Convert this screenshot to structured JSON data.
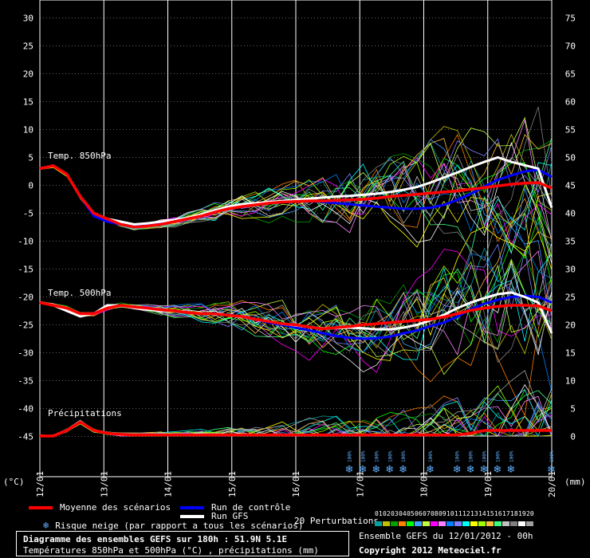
{
  "chart_data": {
    "type": "line",
    "x_dates": [
      "12/01",
      "13/01",
      "14/01",
      "15/01",
      "16/01",
      "17/01",
      "18/01",
      "19/01",
      "20/01"
    ],
    "x_step_hours": 6,
    "left_axis": {
      "unit": "(°C)",
      "ticks": [
        30,
        25,
        20,
        15,
        10,
        5,
        0,
        -5,
        -10,
        -15,
        -20,
        -25,
        -30,
        -35,
        -40,
        -45
      ]
    },
    "right_axis": {
      "unit": "(mm)",
      "ticks": [
        75,
        70,
        65,
        60,
        55,
        50,
        45,
        40,
        35,
        30,
        25,
        20,
        15,
        10,
        5,
        0
      ]
    },
    "panel_labels": [
      "Temp. 850hPa",
      "Temp. 500hPa",
      "Précipitations"
    ],
    "series": [
      {
        "name": "Moyenne des scénarios",
        "color": "#ff0000",
        "t850": [
          3,
          3.5,
          2,
          -2,
          -5,
          -6,
          -7,
          -7.5,
          -7.3,
          -7,
          -6.5,
          -6,
          -5.5,
          -4.8,
          -4.2,
          -3.8,
          -3.5,
          -3.2,
          -3,
          -2.9,
          -2.8,
          -2.8,
          -2.7,
          -2.6,
          -2.5,
          -2.3,
          -2.0,
          -1.8,
          -1.6,
          -1.4,
          -1.2,
          -1.0,
          -0.7,
          -0.4,
          -0.1,
          0.2,
          0.4,
          0.5,
          -0.5
        ],
        "t500": [
          -21,
          -21.5,
          -22,
          -23,
          -23,
          -22,
          -21.5,
          -21.8,
          -22,
          -22.3,
          -22.5,
          -22.8,
          -23,
          -23,
          -23.3,
          -23.5,
          -24,
          -24.4,
          -24.8,
          -25,
          -25.4,
          -25.7,
          -25.5,
          -25.3,
          -25,
          -24.8,
          -24.6,
          -24.4,
          -24.2,
          -24,
          -23.6,
          -23,
          -22.4,
          -22,
          -21.7,
          -21.5,
          -21.5,
          -21.6,
          -22.5
        ],
        "precip": [
          0,
          0,
          1,
          2.5,
          1,
          0.5,
          0.3,
          0.2,
          0.2,
          0.2,
          0.2,
          0.2,
          0.2,
          0.2,
          0.2,
          0.2,
          0.2,
          0.2,
          0.2,
          0.2,
          0.2,
          0.2,
          0.2,
          0.2,
          0.2,
          0.2,
          0.2,
          0.2,
          0.2,
          0.2,
          0.2,
          0.2,
          0.5,
          1,
          1,
          1,
          1,
          1,
          1
        ]
      },
      {
        "name": "Run de contrôle",
        "color": "#0000ff",
        "t850": [
          3,
          3.5,
          2,
          -2,
          -5.5,
          -6.5,
          -7,
          -7.2,
          -7,
          -6.8,
          -6.5,
          -6,
          -5.4,
          -4.6,
          -4,
          -3.6,
          -3.3,
          -3.1,
          -2.9,
          -2.8,
          -2.8,
          -3,
          -3.2,
          -3.4,
          -3.6,
          -3.8,
          -4,
          -4.2,
          -4.2,
          -4,
          -3.5,
          -2.6,
          -1.5,
          -0.2,
          1,
          1.8,
          2.5,
          2.8,
          1.5
        ],
        "t500": [
          -21,
          -21.5,
          -22,
          -23,
          -23,
          -22,
          -21.5,
          -21.8,
          -22,
          -22.3,
          -22.5,
          -22.8,
          -23,
          -23,
          -23.2,
          -23.5,
          -24,
          -24.6,
          -25,
          -25.5,
          -26,
          -26.5,
          -27,
          -27.3,
          -27.5,
          -27.4,
          -27.1,
          -26.5,
          -26,
          -25.2,
          -24.6,
          -23.5,
          -22.2,
          -21.2,
          -20.5,
          -20,
          -19.8,
          -20,
          -21
        ]
      },
      {
        "name": "Run GFS",
        "color": "#ffffff",
        "t850": [
          3,
          3.5,
          2,
          -2,
          -5,
          -6,
          -6.5,
          -7,
          -6.8,
          -6.5,
          -6.2,
          -5.8,
          -5.2,
          -4.5,
          -3.8,
          -3.4,
          -3.2,
          -3,
          -2.8,
          -2.6,
          -2.4,
          -2.2,
          -2,
          -1.9,
          -1.7,
          -1.5,
          -1.2,
          -0.8,
          -0.3,
          0.5,
          1.4,
          2.3,
          3.3,
          4.2,
          5,
          4.2,
          3.6,
          3,
          -4
        ],
        "t500": [
          -21,
          -21.5,
          -22.5,
          -23.5,
          -23,
          -21.5,
          -21.5,
          -22,
          -22.3,
          -22.5,
          -22.5,
          -22.8,
          -23,
          -23,
          -23.3,
          -23.6,
          -24,
          -24.4,
          -24.8,
          -25.1,
          -25.4,
          -25.6,
          -25.6,
          -25.5,
          -25.6,
          -25.8,
          -25.8,
          -25.5,
          -25,
          -24.2,
          -23.2,
          -22,
          -21,
          -20.2,
          -19.5,
          -19.2,
          -20,
          -21,
          -26.5
        ]
      }
    ]
  },
  "legend": {
    "mean_label": "Moyenne des scénarios",
    "control_label": "Run de contrôle",
    "gfs_label": "Run GFS",
    "snow_label": "Risque neige (par rapport a tous les scénarios)",
    "snow_percent": "100%",
    "perturbations_label": "20 Perturbations",
    "perturbation_numbers": [
      "01",
      "02",
      "03",
      "04",
      "05",
      "06",
      "07",
      "08",
      "09",
      "10",
      "11",
      "12",
      "13",
      "14",
      "15",
      "16",
      "17",
      "18",
      "19",
      "20"
    ],
    "perturbation_colors": [
      "#00a0a0",
      "#c0c000",
      "#00a000",
      "#ff8000",
      "#00ff00",
      "#40a0ff",
      "#c0ff40",
      "#ff00ff",
      "#ff80ff",
      "#0080ff",
      "#8080ff",
      "#00ffff",
      "#ffff00",
      "#a0ff00",
      "#ffc040",
      "#40ff80",
      "#c0c0c0",
      "#808080",
      "#ffffff",
      "#a0a0a0"
    ],
    "ensemble_info": "Ensemble GEFS du 12/01/2012 - 00h",
    "copyright": "Copyright 2012 Meteociel.fr"
  },
  "footer": {
    "title": "Diagramme des ensembles GEFS sur 180h : 51.9N 5.1E",
    "subtitle": "Températures 850hPa et 500hPa (°C) , précipitations (mm)"
  },
  "colors": {
    "background": "#000000",
    "grid": "#ffffff",
    "text": "#ffffff",
    "snow": "#5fb0ff"
  }
}
